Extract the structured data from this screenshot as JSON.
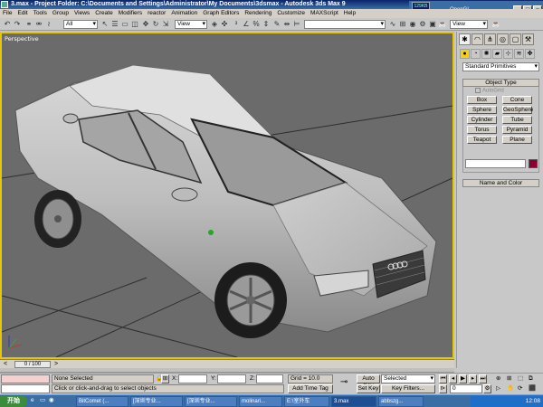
{
  "window": {
    "title": "3.max    - Project Folder: C:\\Documents and Settings\\Administrator\\My Documents\\3dsmax    - Autodesk 3ds Max 9",
    "minimize": "_",
    "maximize": "□",
    "close": "×"
  },
  "tray": {
    "net_top": "129KB",
    "net_bottom": "3%",
    "renderer": "OpenGL"
  },
  "menu": [
    "File",
    "Edit",
    "Tools",
    "Group",
    "Views",
    "Create",
    "Modifiers",
    "reactor",
    "Animation",
    "Graph Editors",
    "Rendering",
    "Customize",
    "MAXScript",
    "Help"
  ],
  "toolbar": {
    "selection_filter": "All",
    "ref_coord": "View",
    "named_selection": "",
    "viewport_menu": "View"
  },
  "viewport": {
    "label": "Perspective"
  },
  "timeslider": {
    "position": "0 / 100",
    "prev": "<",
    "next": ">"
  },
  "command_panel": {
    "tab_icons": [
      "create-tab",
      "modify-tab",
      "hierarchy-tab",
      "motion-tab",
      "display-tab",
      "utilities-tab"
    ],
    "category": "Standard Primitives",
    "object_type_title": "Object Type",
    "autogrid": "AutoGrid",
    "primitives": [
      "Box",
      "Cone",
      "Sphere",
      "GeoSphere",
      "Cylinder",
      "Tube",
      "Torus",
      "Pyramid",
      "Teapot",
      "Plane"
    ],
    "name_color_title": "Name and Color",
    "swatch_color": "#8a0033"
  },
  "status": {
    "selection": "None Selected",
    "prompt": "Click or click-and-drag to select objects",
    "x_label": "X:",
    "y_label": "Y:",
    "z_label": "Z:",
    "x_value": "",
    "y_value": "",
    "z_value": "",
    "grid": "Grid = 10.0",
    "add_time_tag": "Add Time Tag",
    "auto_key": "Auto Key",
    "set_key": "Set Key",
    "key_mode": "Selected",
    "key_filters": "Key Filters...",
    "frame": "0"
  },
  "taskbar": {
    "start": "开始",
    "tasks": [
      "BitComet (...",
      "[深圳专业...",
      "[深圳专业...",
      "molinari...",
      "E:\\室外车",
      "3.max",
      "abbszg..."
    ],
    "time": "12:08"
  }
}
